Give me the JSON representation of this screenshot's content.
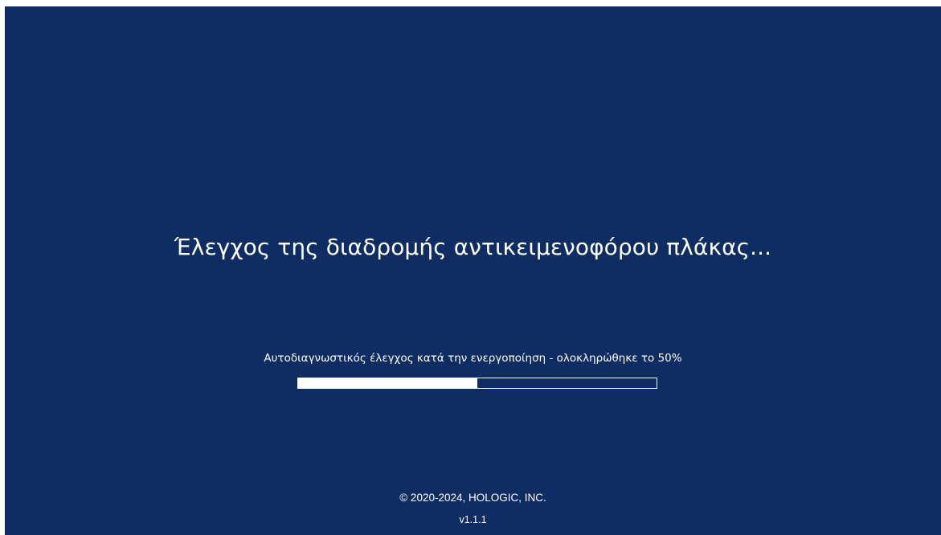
{
  "colors": {
    "background": "#0f2d62",
    "text": "#ffffff",
    "progress_fill": "#ffffff"
  },
  "main": {
    "title": "Έλεγχος της διαδρομής αντικειμενοφόρου πλάκας...",
    "status_text": "Αυτοδιαγνωστικός έλεγχος κατά την ενεργοποίηση - ολοκληρώθηκε το 50%",
    "progress_fraction": 0.5
  },
  "footer": {
    "copyright": "© 2020-2024, HOLOGIC, INC.",
    "version": "v1.1.1"
  }
}
